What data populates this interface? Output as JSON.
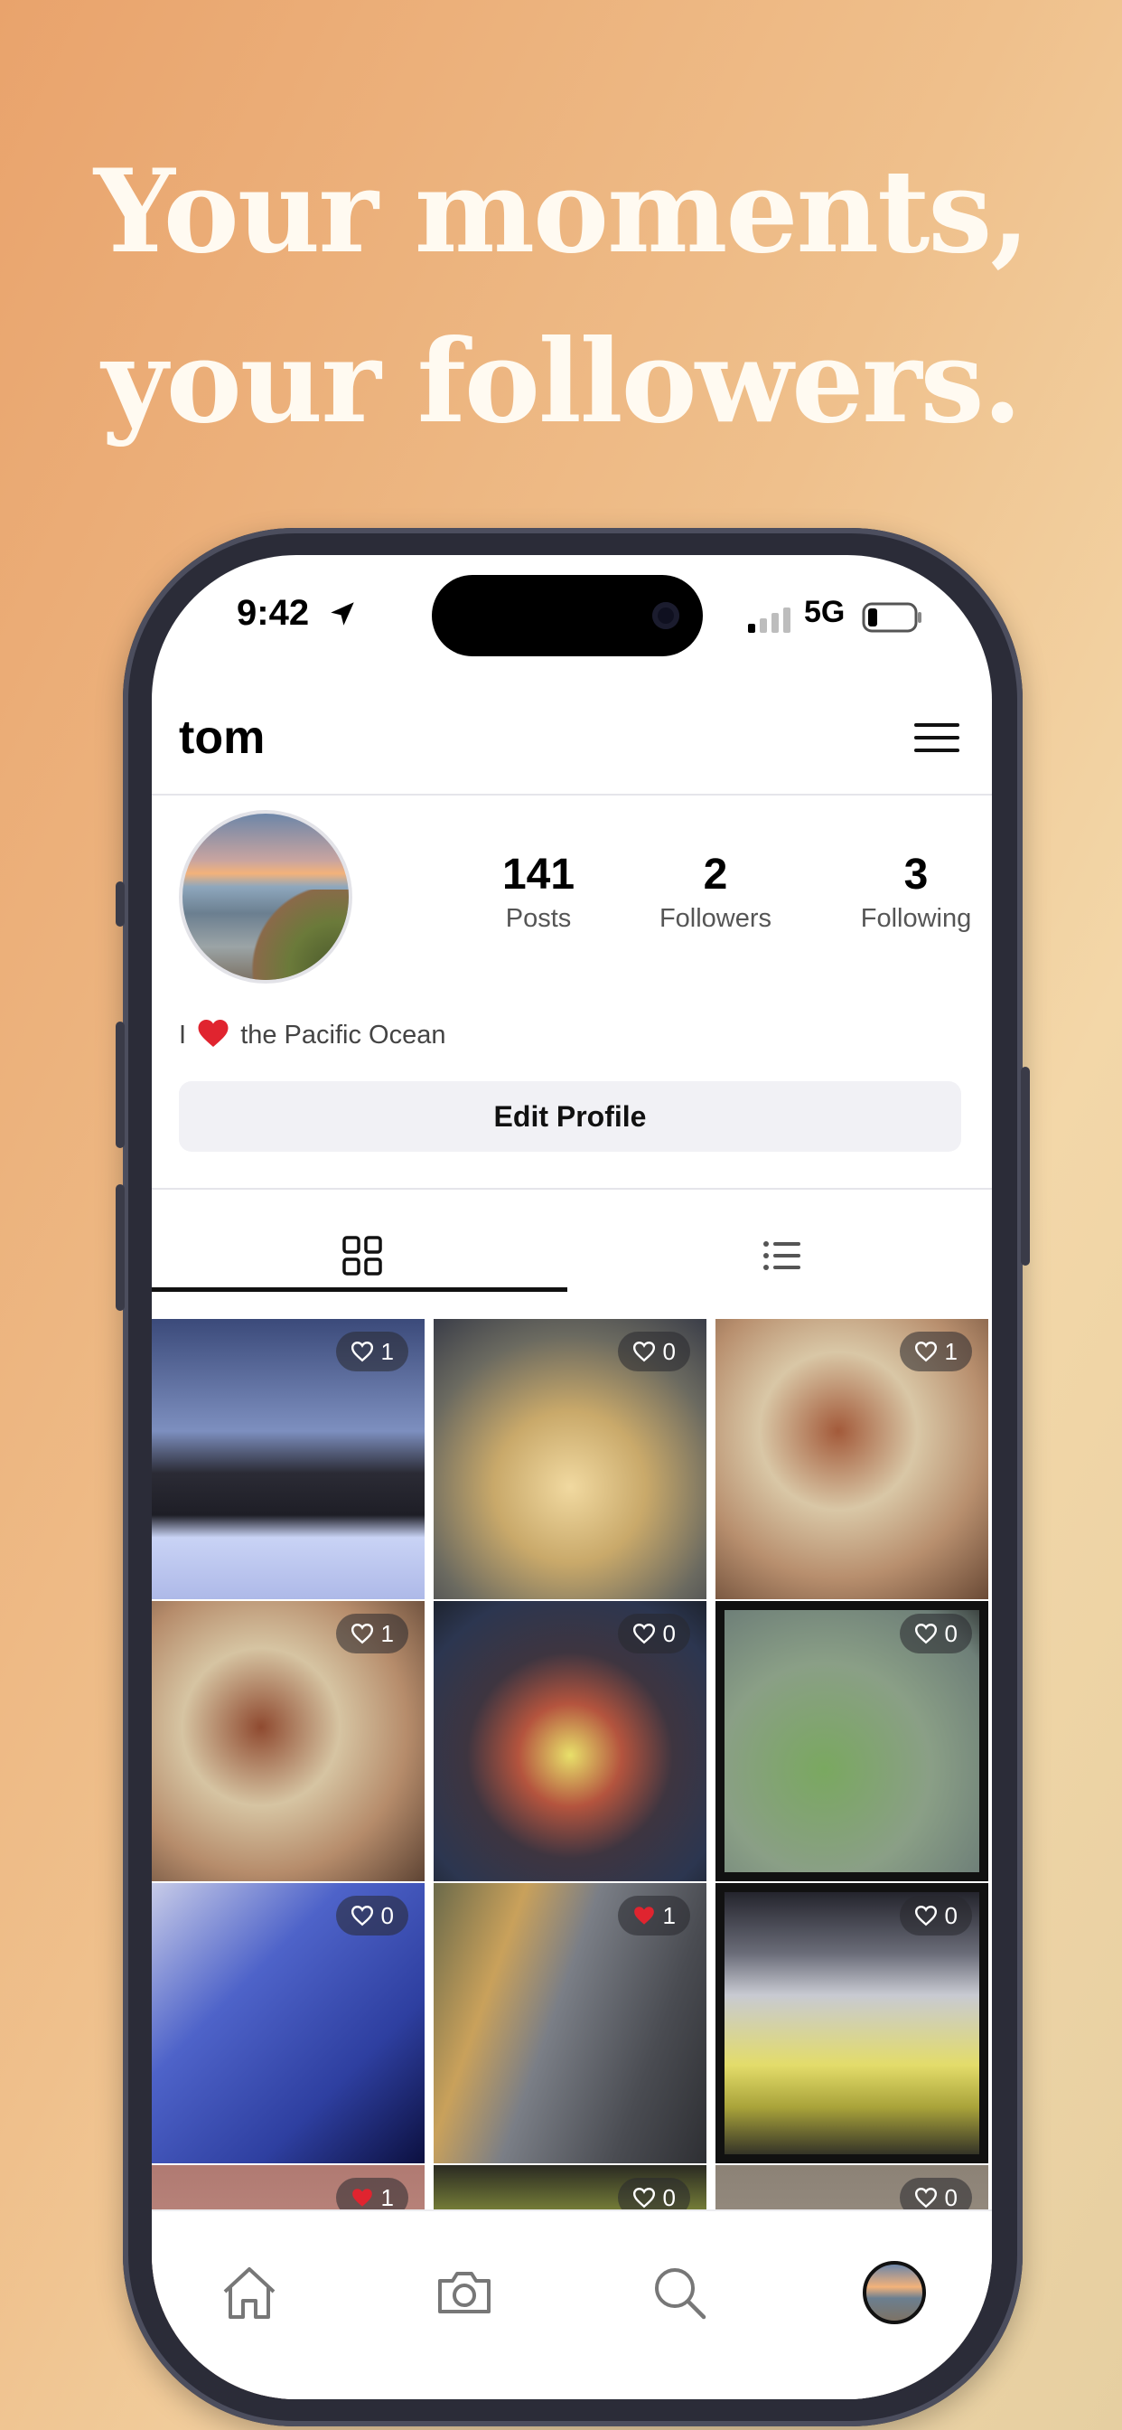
{
  "headline": {
    "line1": "Your moments,",
    "line2": "your followers."
  },
  "status_bar": {
    "time": "9:42",
    "network": "5G"
  },
  "profile": {
    "username": "tom",
    "stats": [
      {
        "value": "141",
        "label": "Posts"
      },
      {
        "value": "2",
        "label": "Followers"
      },
      {
        "value": "3",
        "label": "Following"
      }
    ],
    "bio_prefix": "I",
    "bio_suffix": "the Pacific Ocean",
    "edit_button": "Edit Profile"
  },
  "tabs": [
    {
      "icon": "grid-icon",
      "selected": true
    },
    {
      "icon": "list-icon",
      "selected": false
    }
  ],
  "posts": [
    {
      "likes": "1",
      "liked": false
    },
    {
      "likes": "0",
      "liked": false
    },
    {
      "likes": "1",
      "liked": false
    },
    {
      "likes": "1",
      "liked": false
    },
    {
      "likes": "0",
      "liked": false
    },
    {
      "likes": "0",
      "liked": false
    },
    {
      "likes": "0",
      "liked": false
    },
    {
      "likes": "1",
      "liked": true
    },
    {
      "likes": "0",
      "liked": false
    },
    {
      "likes": "1",
      "liked": true
    },
    {
      "likes": "0",
      "liked": false
    },
    {
      "likes": "0",
      "liked": false
    }
  ],
  "tab_bar": [
    "home-icon",
    "camera-icon",
    "search-icon",
    "profile-avatar"
  ],
  "colors": {
    "accent_heart": "#e0242f",
    "background_start": "#e9a36c",
    "background_end": "#e6cfa1"
  }
}
